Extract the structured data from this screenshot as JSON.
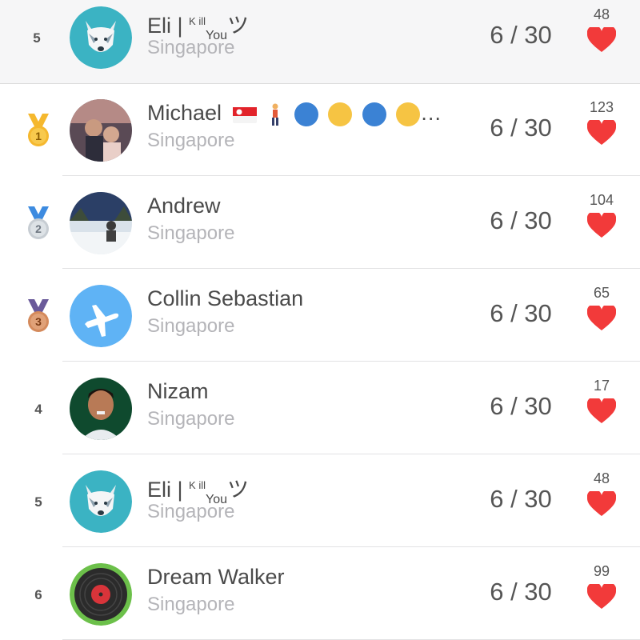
{
  "pinned": {
    "rank": "5",
    "name": "Eli | ",
    "name_sup": "K ill",
    "name_sub": "You",
    "name_tail": "ツ",
    "location": "Singapore",
    "score": "6 / 30",
    "likes": "48",
    "avatar": "wolf-avatar"
  },
  "rows": [
    {
      "rank": "1",
      "medal": "gold",
      "name": "Michael",
      "name_suffix": "…",
      "location": "Singapore",
      "score": "6 / 30",
      "likes": "123",
      "avatar": "photo-avatar"
    },
    {
      "rank": "2",
      "medal": "silver",
      "name": "Andrew",
      "location": "Singapore",
      "score": "6 / 30",
      "likes": "104",
      "avatar": "snow-photo-avatar"
    },
    {
      "rank": "3",
      "medal": "bronze",
      "name": "Collin Sebastian",
      "location": "Singapore",
      "score": "6 / 30",
      "likes": "65",
      "avatar": "airplane-avatar"
    },
    {
      "rank": "4",
      "name": "Nizam",
      "location": "Singapore",
      "score": "6 / 30",
      "likes": "17",
      "avatar": "portrait-avatar"
    },
    {
      "rank": "5",
      "name": "Eli | ",
      "name_sup": "K ill",
      "name_sub": "You",
      "name_tail": "ツ",
      "location": "Singapore",
      "score": "6 / 30",
      "likes": "48",
      "avatar": "wolf-avatar"
    },
    {
      "rank": "6",
      "name": "Dream Walker",
      "location": "Singapore",
      "score": "6 / 30",
      "likes": "99",
      "avatar": "vinyl-record-avatar"
    }
  ],
  "colors": {
    "heart": "#f23a3a",
    "gold": "#f5b82e",
    "silver": "#c7cdd3",
    "bronze": "#d48a5c",
    "location": "#b4b4b8"
  }
}
